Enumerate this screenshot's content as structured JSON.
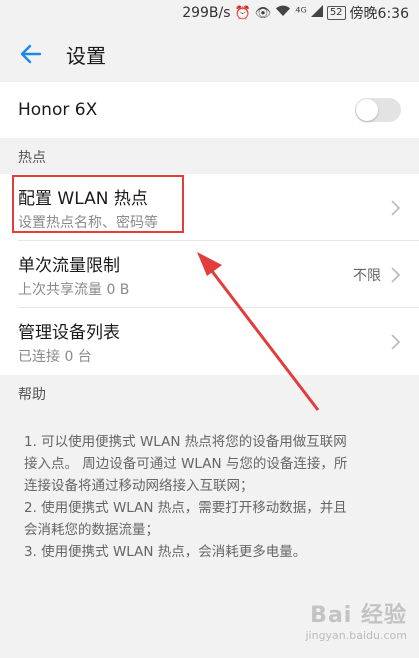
{
  "status_bar": {
    "network_speed": "299B/s",
    "alarm_icon": "alarm-icon",
    "eye_icon": "eye-icon",
    "wifi_icon": "wifi-icon",
    "signal_label": "⁴ᴳ",
    "battery": "52",
    "time": "傍晚6:36"
  },
  "toolbar": {
    "title": "设置"
  },
  "device": {
    "name": "Honor 6X",
    "enabled": false
  },
  "sections": {
    "hotspot_header": "热点",
    "help_header": "帮助"
  },
  "items": [
    {
      "title": "配置 WLAN 热点",
      "subtitle": "设置热点名称、密码等",
      "value": ""
    },
    {
      "title": "单次流量限制",
      "subtitle": "上次共享流量 0 B",
      "value": "不限"
    },
    {
      "title": "管理设备列表",
      "subtitle": "已连接 0 台",
      "value": ""
    }
  ],
  "help": {
    "lines": [
      "1. 可以使用便携式 WLAN 热点将您的设备用做互联网",
      "接入点。 周边设备可通过 WLAN 与您的设备连接，所",
      "连接设备将通过移动网络接入互联网；",
      "2. 使用便携式 WLAN 热点，需要打开移动数据，并且",
      "会消耗您的数据流量；",
      "3. 使用便携式 WLAN 热点，会消耗更多电量。"
    ]
  },
  "watermark": {
    "logo": "Bai 经验",
    "url": "jingyan.baidu.com"
  },
  "colors": {
    "accent": "#1e88e5",
    "annotation": "#e23c3c"
  }
}
